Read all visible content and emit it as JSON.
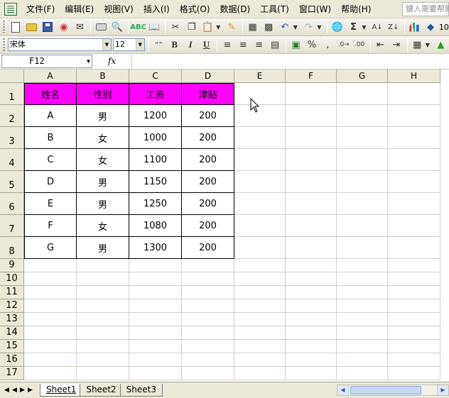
{
  "menu": {
    "items": [
      "文件(F)",
      "编辑(E)",
      "视图(V)",
      "插入(I)",
      "格式(O)",
      "数据(D)",
      "工具(T)",
      "窗口(W)",
      "帮助(H)"
    ],
    "search_placeholder": "键入需要帮助"
  },
  "toolbar": {
    "font_name": "宋体",
    "font_size": "12",
    "percent_label": "%",
    "comma_label": ",",
    "zoom_label": "10"
  },
  "formula_bar": {
    "cell_ref": "F12",
    "fx_label": "fx",
    "content": ""
  },
  "grid": {
    "columns": [
      "A",
      "B",
      "C",
      "D",
      "E",
      "F",
      "G",
      "H"
    ],
    "rows": [
      "1",
      "2",
      "3",
      "4",
      "5",
      "6",
      "7",
      "8",
      "9",
      "10",
      "11",
      "12",
      "13",
      "14",
      "15",
      "16",
      "17"
    ],
    "header_fill": "#ff00ff",
    "header_cells": [
      "姓名",
      "性别",
      "工资",
      "津贴"
    ],
    "records": [
      [
        "A",
        "男",
        "1200",
        "200"
      ],
      [
        "B",
        "女",
        "1000",
        "200"
      ],
      [
        "C",
        "女",
        "1100",
        "200"
      ],
      [
        "D",
        "男",
        "1150",
        "200"
      ],
      [
        "E",
        "男",
        "1250",
        "200"
      ],
      [
        "F",
        "女",
        "1080",
        "200"
      ],
      [
        "G",
        "男",
        "1300",
        "200"
      ]
    ]
  },
  "sheets": {
    "tabs": [
      "Sheet1",
      "Sheet2",
      "Sheet3"
    ],
    "active": "Sheet1"
  }
}
